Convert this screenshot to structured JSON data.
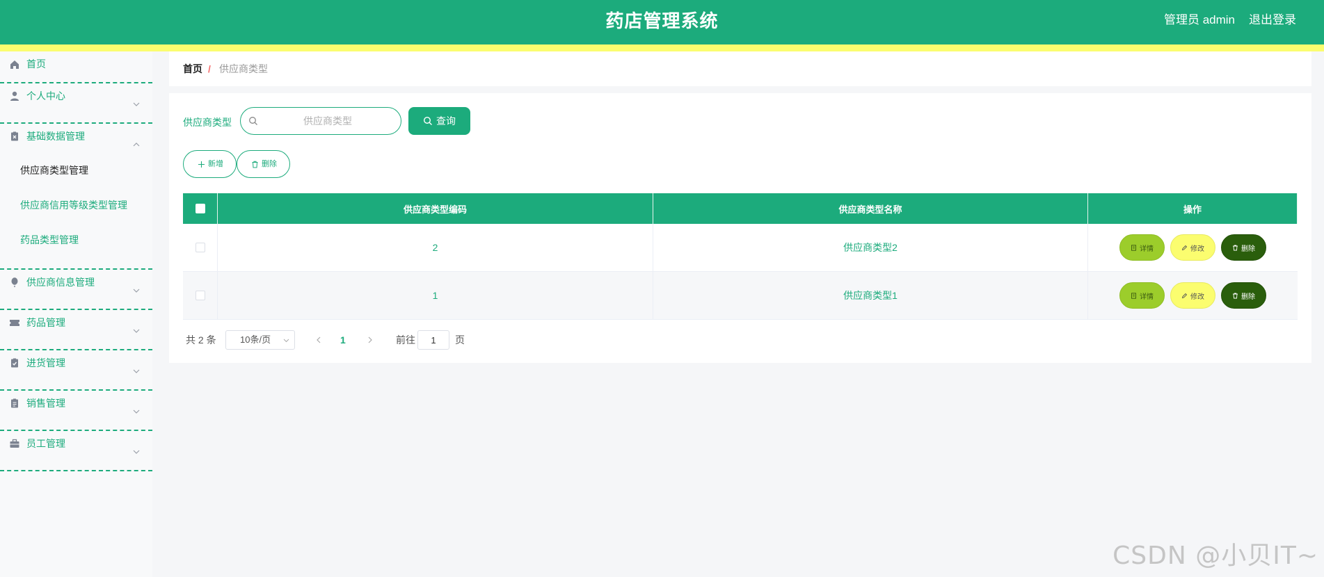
{
  "header": {
    "title": "药店管理系统",
    "user": "管理员 admin",
    "logout": "退出登录"
  },
  "sidebar": {
    "items": [
      {
        "label": "首页",
        "icon": "home-icon"
      },
      {
        "label": "个人中心",
        "icon": "user-icon"
      },
      {
        "label": "基础数据管理",
        "icon": "clipboard-icon",
        "expanded": true,
        "children": [
          "供应商类型管理",
          "供应商信用等级类型管理",
          "药品类型管理"
        ],
        "active_child": "供应商类型管理"
      },
      {
        "label": "供应商信息管理",
        "icon": "balloon-icon"
      },
      {
        "label": "药品管理",
        "icon": "ticket-icon"
      },
      {
        "label": "进货管理",
        "icon": "clipboard-check-icon"
      },
      {
        "label": "销售管理",
        "icon": "document-icon"
      },
      {
        "label": "员工管理",
        "icon": "briefcase-icon"
      }
    ]
  },
  "breadcrumb": {
    "home": "首页",
    "separator": "/",
    "current": "供应商类型"
  },
  "search": {
    "label": "供应商类型",
    "placeholder": "供应商类型",
    "value": "",
    "button": "查询"
  },
  "actions": {
    "add": "新增",
    "delete": "删除"
  },
  "table": {
    "columns": [
      "供应商类型编码",
      "供应商类型名称",
      "操作"
    ],
    "rows": [
      {
        "code": "2",
        "name": "供应商类型2"
      },
      {
        "code": "1",
        "name": "供应商类型1"
      }
    ],
    "row_actions": {
      "detail": "详情",
      "edit": "修改",
      "delete": "删除"
    }
  },
  "pagination": {
    "total": "共 2 条",
    "page_size": "10条/页",
    "current_page": "1",
    "goto_label": "前往",
    "goto_value": "1",
    "page_suffix": "页"
  },
  "watermark": "CSDN @小贝IT~",
  "colors": {
    "primary": "#1cab7c",
    "strip": "#fbfd6f",
    "detail": "#9ccd2b",
    "edit": "#fbfd6f",
    "delete": "#2a5e0c"
  }
}
